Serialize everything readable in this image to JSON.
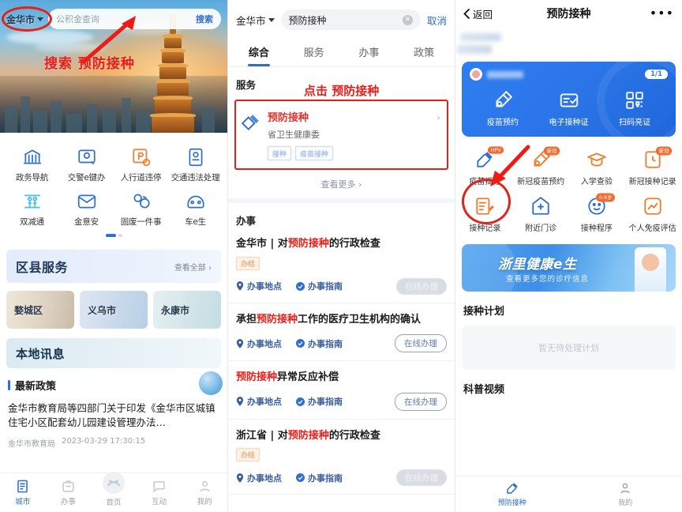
{
  "panel1": {
    "city_selector": "金华市",
    "search_placeholder": "公积金查询",
    "search_button": "搜索",
    "annotation": "搜索 预防接种",
    "icons": [
      {
        "label": "政务导航",
        "icon": "bank-icon"
      },
      {
        "label": "交警e键办",
        "icon": "traffic-police-icon"
      },
      {
        "label": "人行道违停",
        "icon": "sidewalk-parking-icon"
      },
      {
        "label": "交通违法处理",
        "icon": "traffic-violation-icon"
      },
      {
        "label": "双减通",
        "icon": "education-icon"
      },
      {
        "label": "金意安",
        "icon": "envelope-icon"
      },
      {
        "label": "固废一件事",
        "icon": "waste-icon"
      },
      {
        "label": "车e生",
        "icon": "car-icon"
      }
    ],
    "district_section": {
      "title": "区县服务",
      "more": "查看全部 ›",
      "cards": [
        "婺城区",
        "义乌市",
        "永康市"
      ]
    },
    "news_section": {
      "banner_title": "本地讯息",
      "subtitle": "最新政策",
      "headline": "金华市教育局等四部门关于印发《金华市区城镇住宅小区配套幼儿园建设管理办法…",
      "source": "金华市教育局",
      "time": "2023-03-29 17:30:15"
    },
    "tabbar": [
      {
        "label": "城市",
        "icon": "city-icon",
        "active": true
      },
      {
        "label": "办事",
        "icon": "affairs-icon",
        "active": false
      },
      {
        "label": "首页",
        "icon": "home-icon",
        "active": false
      },
      {
        "label": "互动",
        "icon": "interact-icon",
        "active": false
      },
      {
        "label": "我的",
        "icon": "profile-icon",
        "active": false
      }
    ]
  },
  "panel2": {
    "city_selector": "金华市",
    "search_value": "预防接种",
    "cancel": "取消",
    "tabs": [
      {
        "label": "综合",
        "active": true
      },
      {
        "label": "服务",
        "active": false
      },
      {
        "label": "办事",
        "active": false
      },
      {
        "label": "政策",
        "active": false
      }
    ],
    "service_section_title": "服务",
    "annotation": "点击 预防接种",
    "service_card": {
      "title": "预防接种",
      "subtitle": "省卫生健康委",
      "tags": [
        "接种",
        "疫苗接种"
      ]
    },
    "more_label": "查看更多 ›",
    "affairs_section_title": "办事",
    "affairs": [
      {
        "prefix": "金华市 | 对",
        "highlight": "预防接种",
        "suffix": "的行政检查",
        "tag": "办结",
        "location": "办事地点",
        "guide": "办事指南",
        "action": "在线办理",
        "action_disabled": true
      },
      {
        "prefix": "承担",
        "highlight": "预防接种",
        "suffix": "工作的医疗卫生机构的确认",
        "tag": "",
        "location": "办事地点",
        "guide": "办事指南",
        "action": "在线办理",
        "action_disabled": false
      },
      {
        "prefix": "",
        "highlight": "预防接种",
        "suffix": "异常反应补偿",
        "tag": "",
        "location": "办事地点",
        "guide": "办事指南",
        "action": "在线办理",
        "action_disabled": false
      },
      {
        "prefix": "浙江省 | 对",
        "highlight": "预防接种",
        "suffix": "的行政检查",
        "tag": "办结",
        "location": "办事地点",
        "guide": "办事指南",
        "action": "在线办理",
        "action_disabled": true
      }
    ]
  },
  "panel3": {
    "back": "返回",
    "title": "预防接种",
    "menu": "•••",
    "user_card": {
      "page_badge": "1/1",
      "actions": [
        {
          "label": "疫苗预约",
          "icon": "vaccine-appointment-icon"
        },
        {
          "label": "电子接种证",
          "icon": "certificate-icon"
        },
        {
          "label": "扫码亮证",
          "icon": "qr-code-icon"
        }
      ]
    },
    "grid": [
      {
        "label": "疫苗摇号",
        "icon": "vaccine-lottery-icon",
        "badge": "HPV"
      },
      {
        "label": "新冠疫苗预约",
        "icon": "covid-appointment-icon",
        "badge": "新冠"
      },
      {
        "label": "入学查验",
        "icon": "school-check-icon",
        "badge": ""
      },
      {
        "label": "新冠接种记录",
        "icon": "covid-record-icon",
        "badge": "新冠"
      },
      {
        "label": "接种记录",
        "icon": "record-icon",
        "badge": ""
      },
      {
        "label": "附近门诊",
        "icon": "nearby-clinic-icon",
        "badge": ""
      },
      {
        "label": "接种程序",
        "icon": "schedule-icon",
        "badge": "0-6岁"
      },
      {
        "label": "个人免疫评估",
        "icon": "assessment-icon",
        "badge": ""
      }
    ],
    "banner": {
      "title": "浙里健康e生",
      "subtitle": "查看更多您的诊疗信息"
    },
    "plan_section_title": "接种计划",
    "plan_empty": "暂无待处理计划",
    "video_section_title": "科普视频",
    "tabbar": [
      {
        "label": "预防接种",
        "icon": "vaccine-icon",
        "active": true
      },
      {
        "label": "我的",
        "icon": "profile-icon",
        "active": false
      }
    ]
  },
  "colors": {
    "primary_blue": "#2f6fd0",
    "annotation_red": "#ee1c17",
    "card_blue": "#2f7ef0",
    "orange": "#f26a2e"
  }
}
